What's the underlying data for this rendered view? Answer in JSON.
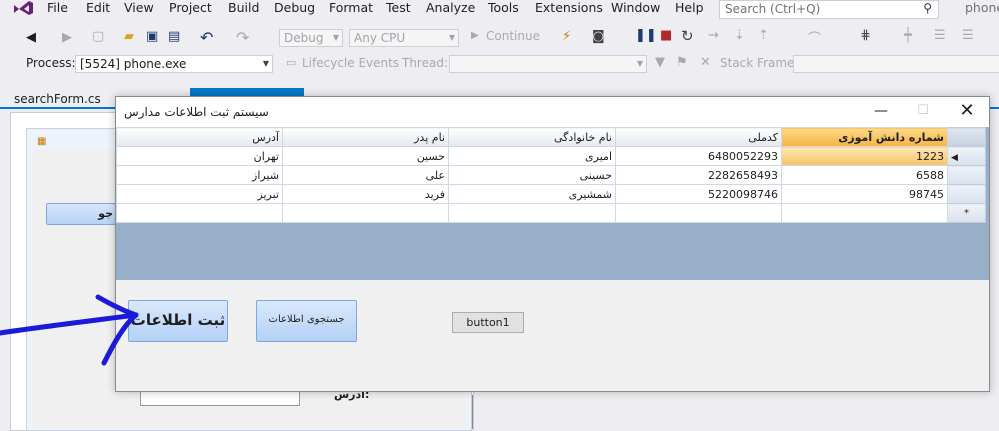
{
  "menu": {
    "items": [
      "File",
      "Edit",
      "View",
      "Project",
      "Build",
      "Debug",
      "Format",
      "Test",
      "Analyze",
      "Tools",
      "Extensions",
      "Window",
      "Help"
    ],
    "search_placeholder": "Search (Ctrl+Q)",
    "solution_name": "phone"
  },
  "toolbar": {
    "config_combo": "Debug",
    "platform_combo": "Any CPU",
    "continue_label": "Continue",
    "process_label": "Process:",
    "process_value": "[5524] phone.exe",
    "lifecycle_label": "Lifecycle Events",
    "thread_label": "Thread:",
    "stack_frame_label": "Stack Frame:"
  },
  "tabs": {
    "active_doc": "searchForm.cs"
  },
  "designer": {
    "button_text": "جو",
    "address_label": "آدرس:"
  },
  "app_window": {
    "title": "سیستم ثبت اطلاعات مدارس",
    "grid": {
      "columns": [
        "آدرس",
        "نام پدر",
        "نام خانوادگی",
        "کدملی",
        "شماره دانش آموزی"
      ],
      "rows": [
        [
          "تهران",
          "حسین",
          "امیری",
          "6480052293",
          "1223"
        ],
        [
          "شیراز",
          "علی",
          "حسینی",
          "2282658493",
          "6588"
        ],
        [
          "تبریز",
          "فرید",
          "شمشیری",
          "5220098746",
          "98745"
        ]
      ],
      "new_row_marker": "*"
    },
    "buttons": {
      "register": "ثبت اطلاعات",
      "search": "جستجوی اطلاعات",
      "button1": "button1"
    }
  },
  "colors": {
    "accent": "#007acc",
    "annotation": "#1a1ad8",
    "grid_background": "#97afc9",
    "selected_cell": "#f7c265"
  }
}
